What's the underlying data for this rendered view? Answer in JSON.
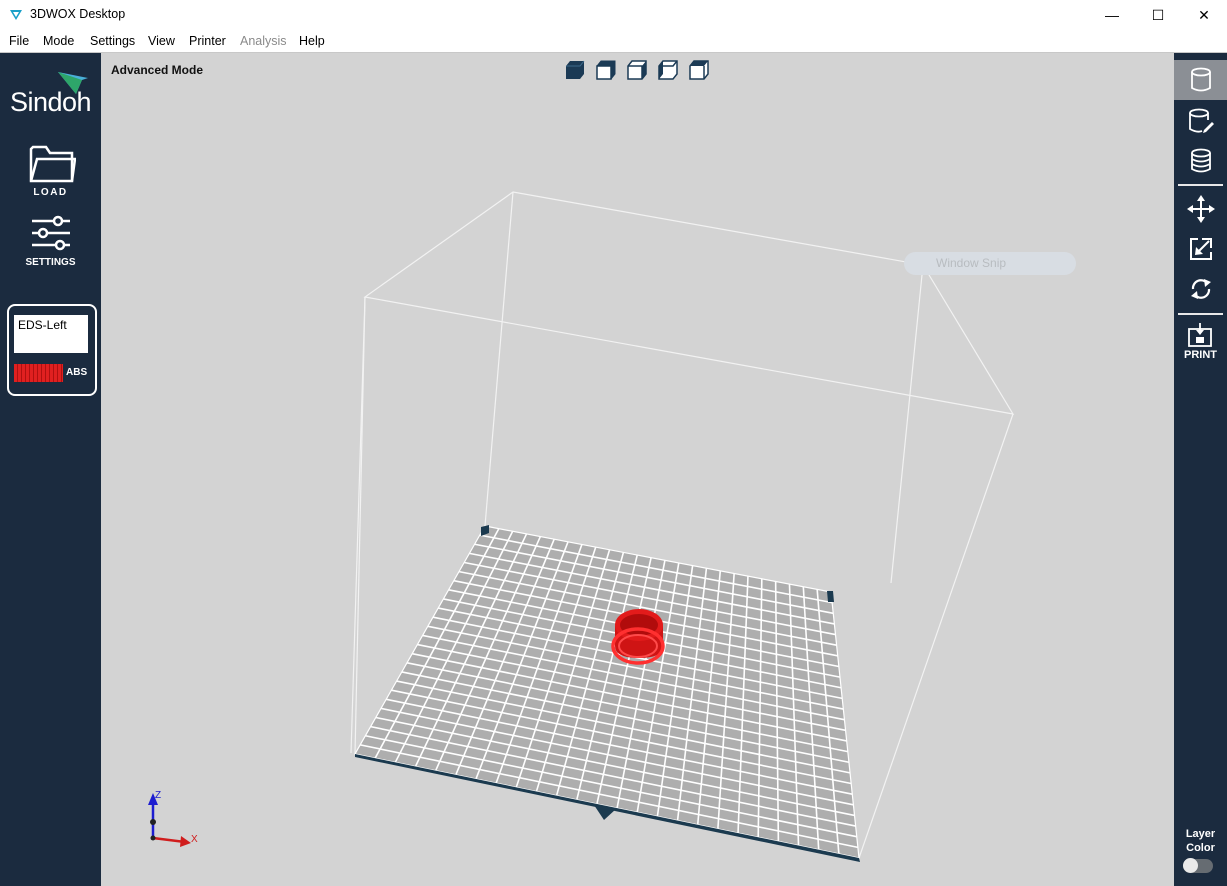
{
  "window": {
    "title": "3DWOX Desktop",
    "minimize": "—",
    "maximize": "☐",
    "close": "✕"
  },
  "menu": [
    {
      "label": "File",
      "enabled": true
    },
    {
      "label": "Mode",
      "enabled": true
    },
    {
      "label": "Settings",
      "enabled": true
    },
    {
      "label": "View",
      "enabled": true
    },
    {
      "label": "Printer",
      "enabled": true
    },
    {
      "label": "Analysis",
      "enabled": false
    },
    {
      "label": "Help",
      "enabled": true
    }
  ],
  "sidebar": {
    "brand": "Sindoh",
    "load_label": "LOAD",
    "settings_label": "SETTINGS",
    "material": {
      "extruder": "EDS-Left",
      "type": "ABS",
      "color": "#e02020"
    }
  },
  "viewport": {
    "mode_label": "Advanced Mode",
    "view_buttons": [
      "view-iso-icon",
      "view-front-icon",
      "view-side-icon",
      "view-left-icon",
      "view-top-icon"
    ],
    "overlay": "Window Snip",
    "axes": {
      "z": "Z",
      "x": "X"
    },
    "model_color": "#e21b1b"
  },
  "toolbar": {
    "tools": [
      "object-icon",
      "object-edit-icon",
      "layers-icon",
      "move-icon",
      "scale-icon",
      "rotate-icon",
      "print-icon"
    ],
    "print_label": "PRINT",
    "layer_color_label_1": "Layer",
    "layer_color_label_2": "Color",
    "layer_color_on": false
  }
}
